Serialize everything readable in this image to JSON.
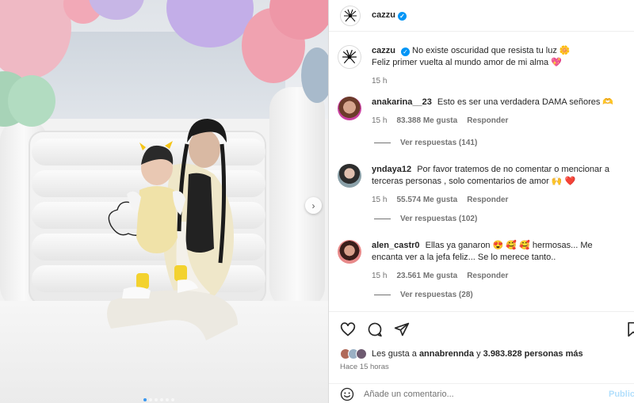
{
  "post": {
    "username": "cazzu",
    "verified": true,
    "caption_line1": "No existe oscuridad que resista tu luz 🌼",
    "caption_line2": "Feliz primer vuelta al mundo amor de mi alma 💖",
    "caption_time": "15 h"
  },
  "comments": [
    {
      "username": "anakarina__23",
      "text": "Esto es ser una verdadera DAMA señores 🫶",
      "time": "15 h",
      "likes": "83.388 Me gusta",
      "reply_label": "Responder",
      "view_replies": "Ver respuestas (141)"
    },
    {
      "username": "yndaya12",
      "text": "Por favor tratemos de no comentar o mencionar a terceras personas , solo comentarios de amor 🙌 ❤️",
      "time": "15 h",
      "likes": "55.574 Me gusta",
      "reply_label": "Responder",
      "view_replies": "Ver respuestas (102)"
    },
    {
      "username": "alen_castr0",
      "text": "Ellas ya ganaron 😍 🥰 🥰 hermosas... Me encanta ver a la jefa feliz... Se lo merece tanto..",
      "time": "15 h",
      "likes": "23.561 Me gusta",
      "reply_label": "Responder",
      "view_replies": "Ver respuestas (28)"
    }
  ],
  "likes_summary": {
    "prefix": "Les gusta a",
    "user": "annabrennda",
    "connector": "y",
    "count": "3.983.828 personas más"
  },
  "time_ago": "Hace 15 horas",
  "comment_box": {
    "placeholder": "Añade un comentario...",
    "publish_label": "Publicar"
  },
  "icons": {
    "like": "heart-icon",
    "comment": "comment-bubble-icon",
    "share": "paper-plane-icon",
    "save": "bookmark-icon",
    "emoji": "smiley-icon",
    "next": "chevron-right-icon"
  },
  "carousel": {
    "total": 6,
    "active": 0
  },
  "colors": {
    "verified": "#0095f6",
    "link_disabled": "#b2dffc",
    "muted_text": "#737373"
  }
}
